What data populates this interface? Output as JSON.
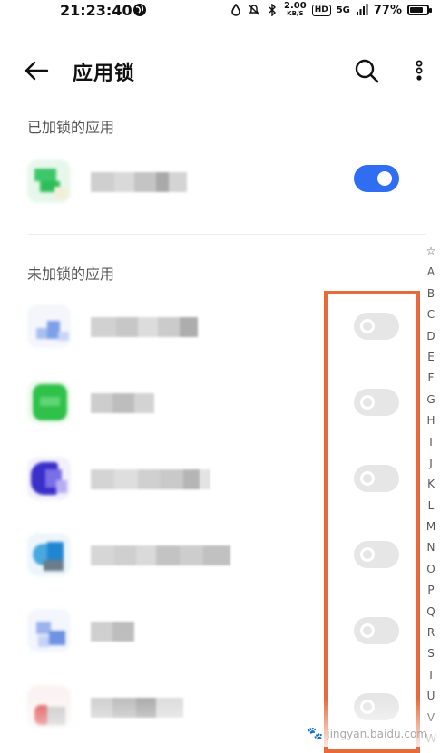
{
  "status_bar": {
    "time": "21:23:40",
    "net_speed_value": "2.00",
    "net_speed_unit": "KB/S",
    "hd_label": "HD",
    "signal_label": "5G",
    "battery_percent": "77%",
    "battery_level": 0.77
  },
  "header": {
    "title": "应用锁",
    "back_icon": "arrow-left-icon",
    "search_icon": "search-icon",
    "more_icon": "more-vertical-icon"
  },
  "locked_section": {
    "title": "已加锁的应用",
    "apps": [
      {
        "name": "",
        "enabled": true
      }
    ]
  },
  "unlocked_section": {
    "title": "未加锁的应用",
    "apps": [
      {
        "name": "",
        "enabled": false
      },
      {
        "name": "",
        "enabled": false
      },
      {
        "name": "",
        "enabled": false
      },
      {
        "name": "",
        "enabled": false
      },
      {
        "name": "",
        "enabled": false
      },
      {
        "name": "",
        "enabled": false
      }
    ]
  },
  "alphabet_index": [
    "☆",
    "A",
    "B",
    "C",
    "D",
    "E",
    "F",
    "G",
    "H",
    "I",
    "J",
    "K",
    "L",
    "M",
    "N",
    "O",
    "P",
    "Q",
    "R",
    "S",
    "T",
    "U",
    "V",
    "W"
  ],
  "colors": {
    "toggle_on": "#2f6ef2",
    "toggle_off": "#e6e6e6",
    "highlight_border": "#e8693a"
  },
  "watermark": {
    "text": "jingyan.baidu.com"
  }
}
